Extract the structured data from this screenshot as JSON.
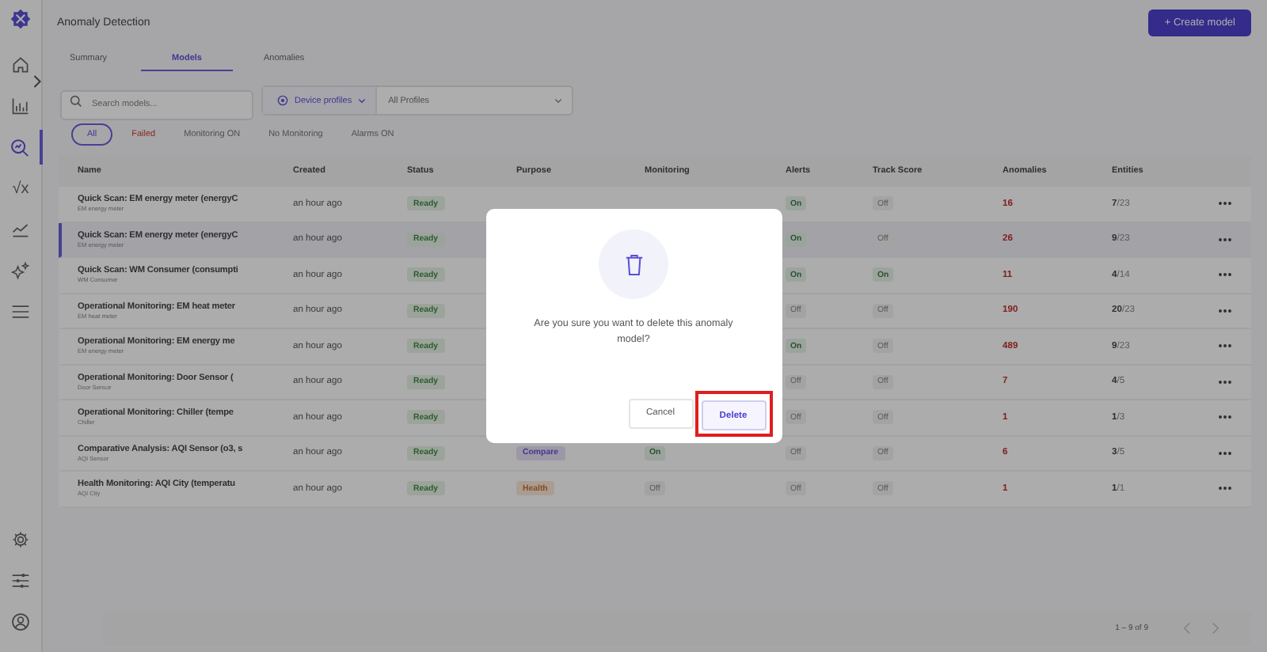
{
  "sidebar": {
    "items": [
      {
        "kind": "home",
        "selected": false
      },
      {
        "kind": "chart",
        "selected": false
      },
      {
        "kind": "search",
        "selected": true
      },
      {
        "kind": "formula",
        "label": "√x",
        "selected": false
      },
      {
        "kind": "trend",
        "selected": false
      },
      {
        "kind": "sparkle",
        "selected": false
      },
      {
        "kind": "menu",
        "selected": false
      }
    ],
    "bottom_items": [
      {
        "kind": "settings"
      },
      {
        "kind": "sliders"
      },
      {
        "kind": "user"
      }
    ]
  },
  "page": {
    "title": "Anomaly Detection",
    "create_button": "+ Create model"
  },
  "tabs": [
    {
      "label": "Summary",
      "selected": false
    },
    {
      "label": "Models",
      "selected": true
    },
    {
      "label": "Anomalies",
      "selected": false
    }
  ],
  "search": {
    "placeholder": "Search models..."
  },
  "profile_filter": {
    "label": "Device profiles",
    "value": "All Profiles"
  },
  "chips": [
    {
      "label": "All",
      "selected": true,
      "kind": "normal"
    },
    {
      "label": "Failed",
      "selected": false,
      "kind": "danger"
    },
    {
      "label": "Monitoring ON",
      "selected": false,
      "kind": "normal"
    },
    {
      "label": "No Monitoring",
      "selected": false,
      "kind": "normal"
    },
    {
      "label": "Alarms ON",
      "selected": false,
      "kind": "normal"
    }
  ],
  "table": {
    "columns": [
      "Name",
      "Created",
      "Status",
      "Purpose",
      "Monitoring",
      "Alerts",
      "Track Score",
      "Anomalies",
      "Entities"
    ],
    "rows": [
      {
        "name": "Quick Scan: EM energy meter (energyC",
        "device": "EM energy meter",
        "created": "an hour ago",
        "status": "Ready",
        "alerts": {
          "text": "On",
          "on": true
        },
        "track_score": {
          "text": "Off",
          "on": false
        },
        "anomalies": "16",
        "entities_used": "7",
        "entities_total": "/23",
        "selected": false
      },
      {
        "name": "Quick Scan: EM energy meter (energyC",
        "device": "EM energy meter",
        "created": "an hour ago",
        "status": "Ready",
        "alerts": {
          "text": "On",
          "on": true
        },
        "track_score": {
          "text": "Off",
          "on": false
        },
        "anomalies": "26",
        "entities_used": "9",
        "entities_total": "/23",
        "selected": true
      },
      {
        "name": "Quick Scan: WM Consumer (consumpti",
        "device": "WM Consumer",
        "created": "an hour ago",
        "status": "Ready",
        "alerts": {
          "text": "On",
          "on": true
        },
        "track_score": {
          "text": "On",
          "on": true
        },
        "anomalies": "11",
        "entities_used": "4",
        "entities_total": "/14",
        "selected": false
      },
      {
        "name": "Operational Monitoring: EM heat meter",
        "device": "EM heat meter",
        "created": "an hour ago",
        "status": "Ready",
        "alerts": {
          "text": "Off",
          "on": false
        },
        "track_score": {
          "text": "Off",
          "on": false
        },
        "anomalies": "190",
        "entities_used": "20",
        "entities_total": "/23",
        "selected": false
      },
      {
        "name": "Operational Monitoring: EM energy me",
        "device": "EM energy meter",
        "created": "an hour ago",
        "status": "Ready",
        "alerts": {
          "text": "On",
          "on": true
        },
        "track_score": {
          "text": "Off",
          "on": false
        },
        "anomalies": "489",
        "entities_used": "9",
        "entities_total": "/23",
        "selected": false
      },
      {
        "name": "Operational Monitoring: Door Sensor (",
        "device": "Door Sensor",
        "created": "an hour ago",
        "status": "Ready",
        "alerts": {
          "text": "Off",
          "on": false
        },
        "track_score": {
          "text": "Off",
          "on": false
        },
        "anomalies": "7",
        "entities_used": "4",
        "entities_total": "/5",
        "selected": false
      },
      {
        "name": "Operational Monitoring: Chiller (tempe",
        "device": "Chiller",
        "created": "an hour ago",
        "status": "Ready",
        "alerts": {
          "text": "Off",
          "on": false
        },
        "track_score": {
          "text": "Off",
          "on": false
        },
        "anomalies": "1",
        "entities_used": "1",
        "entities_total": "/3",
        "selected": false
      },
      {
        "name": "Comparative Analysis: AQI Sensor (o3, s",
        "device": "AQI Sensor",
        "created": "an hour ago",
        "status": "Ready",
        "purpose": {
          "text": "Compare",
          "kind": "compare"
        },
        "monitoring": {
          "text": "On",
          "on": true
        },
        "alerts": {
          "text": "Off",
          "on": false
        },
        "track_score": {
          "text": "Off",
          "on": false
        },
        "anomalies": "6",
        "entities_used": "3",
        "entities_total": "/5",
        "selected": false
      },
      {
        "name": "Health Monitoring: AQI City (temperatu",
        "device": "AQI City",
        "created": "an hour ago",
        "status": "Ready",
        "purpose": {
          "text": "Health",
          "kind": "health"
        },
        "monitoring": {
          "text": "Off",
          "on": false
        },
        "alerts": {
          "text": "Off",
          "on": false
        },
        "track_score": {
          "text": "Off",
          "on": false
        },
        "anomalies": "1",
        "entities_used": "1",
        "entities_total": "/1",
        "selected": false
      }
    ]
  },
  "pagination": {
    "range": "1 – 9 of 9",
    "prev_disabled": true,
    "next_disabled": true
  },
  "dialog": {
    "message": "Are you sure you want to delete this anomaly model?",
    "cancel": "Cancel",
    "confirm": "Delete",
    "confirm_highlighted": true
  }
}
